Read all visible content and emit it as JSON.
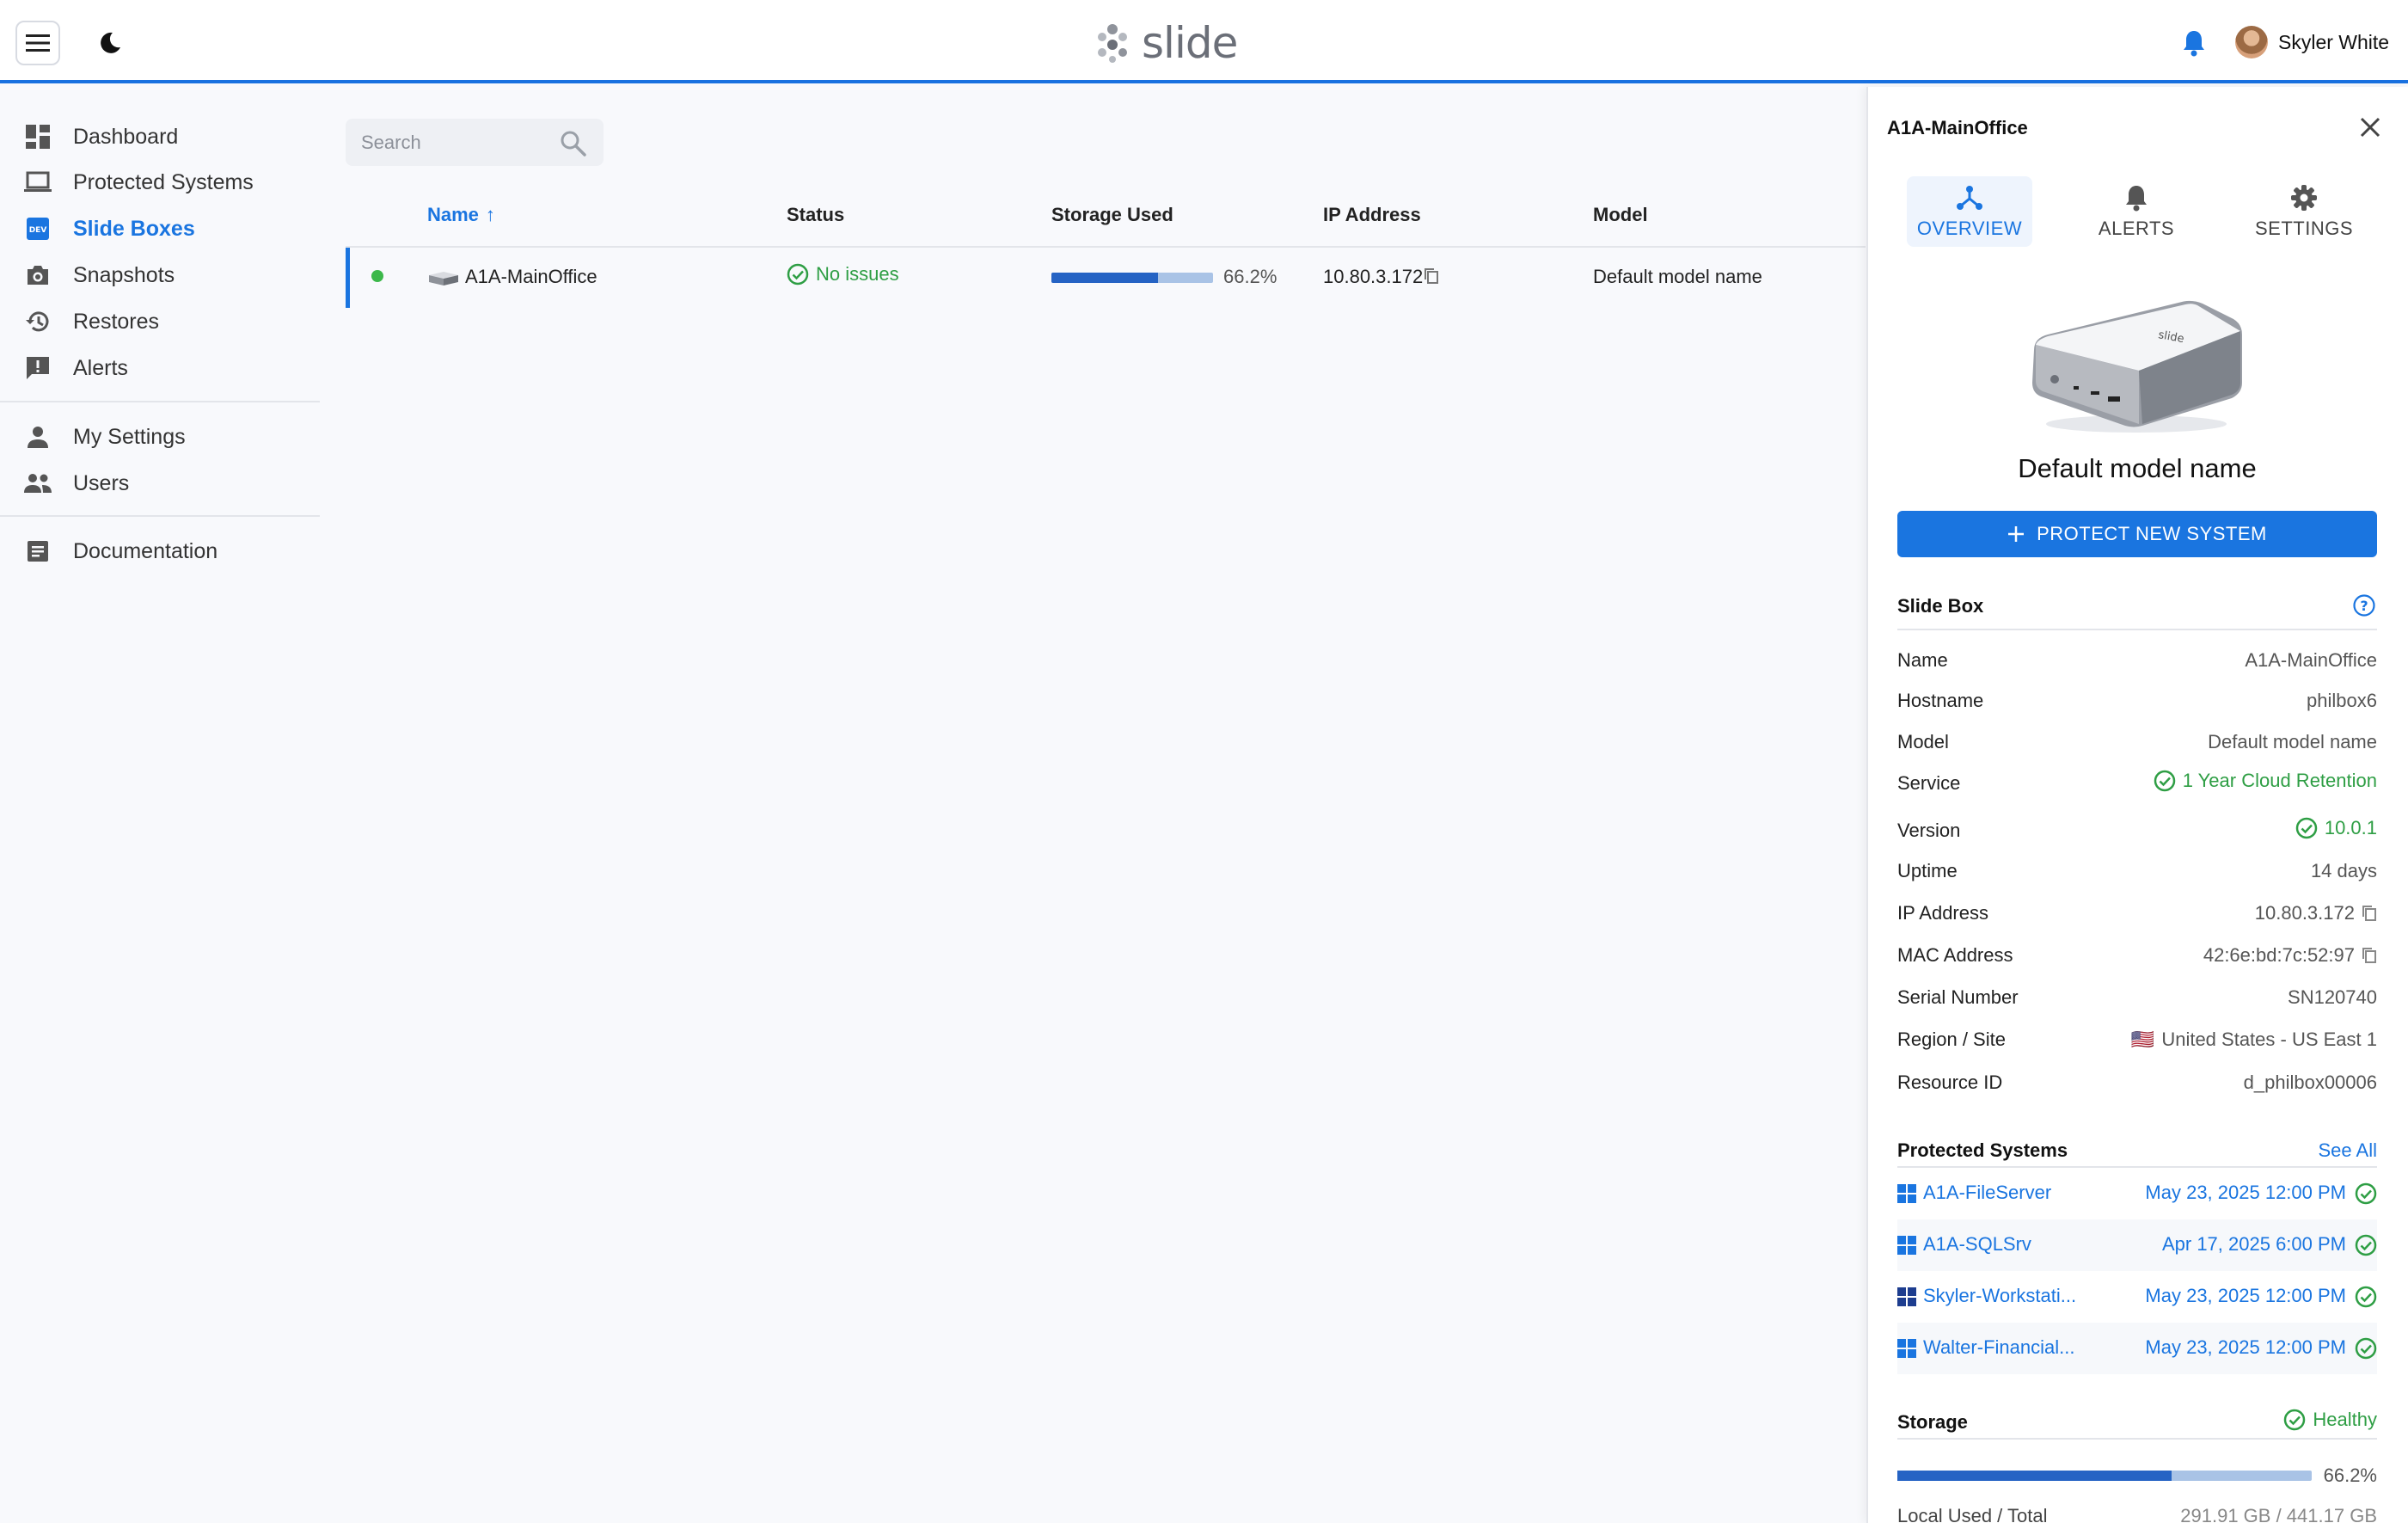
{
  "header": {
    "logo_text": "slide",
    "username": "Skyler White",
    "accent_color": "#1a75e0"
  },
  "sidebar": {
    "items": [
      {
        "label": "Dashboard",
        "icon": "dashboard-icon"
      },
      {
        "label": "Protected Systems",
        "icon": "laptop-icon"
      },
      {
        "label": "Slide Boxes",
        "icon": "dev-box-icon",
        "badge": "DEV",
        "active": true
      },
      {
        "label": "Snapshots",
        "icon": "camera-icon"
      },
      {
        "label": "Restores",
        "icon": "history-icon"
      },
      {
        "label": "Alerts",
        "icon": "alert-icon"
      },
      {
        "label": "My Settings",
        "icon": "person-icon"
      },
      {
        "label": "Users",
        "icon": "people-icon"
      },
      {
        "label": "Documentation",
        "icon": "document-icon"
      }
    ]
  },
  "search": {
    "placeholder": "Search"
  },
  "table": {
    "columns": [
      "Name",
      "Status",
      "Storage Used",
      "IP Address",
      "Model"
    ],
    "sort_indicator": "↑",
    "rows": [
      {
        "name": "A1A-MainOffice",
        "status": "No issues",
        "storage_percent": 66.2,
        "storage_label": "66.2%",
        "ip": "10.80.3.172",
        "model": "Default model name"
      }
    ]
  },
  "panel": {
    "title": "A1A-MainOffice",
    "tabs": [
      {
        "label": "OVERVIEW",
        "icon": "hub-icon",
        "active": true
      },
      {
        "label": "ALERTS",
        "icon": "bell-icon"
      },
      {
        "label": "SETTINGS",
        "icon": "gear-icon"
      }
    ],
    "device_print": "slide",
    "model_name": "Default model name",
    "protect_button": "PROTECT NEW SYSTEM",
    "slide_box": {
      "title": "Slide Box",
      "fields": [
        {
          "label": "Name",
          "value": "A1A-MainOffice"
        },
        {
          "label": "Hostname",
          "value": "philbox6"
        },
        {
          "label": "Model",
          "value": "Default model name"
        },
        {
          "label": "Service",
          "value": "1 Year Cloud Retention",
          "status": "ok"
        },
        {
          "label": "Version",
          "value": "10.0.1",
          "status": "ok"
        },
        {
          "label": "Uptime",
          "value": "14 days"
        },
        {
          "label": "IP Address",
          "value": "10.80.3.172",
          "copy": true
        },
        {
          "label": "MAC Address",
          "value": "42:6e:bd:7c:52:97",
          "copy": true
        },
        {
          "label": "Serial Number",
          "value": "SN120740"
        },
        {
          "label": "Region / Site",
          "value": "United States - US East 1",
          "flag": "🇺🇸"
        },
        {
          "label": "Resource ID",
          "value": "d_philbox00006"
        }
      ]
    },
    "protected_systems": {
      "title": "Protected Systems",
      "see_all": "See All",
      "items": [
        {
          "name": "A1A-FileServer",
          "date": "May 23, 2025 12:00 PM"
        },
        {
          "name": "A1A-SQLSrv",
          "date": "Apr 17, 2025 6:00 PM"
        },
        {
          "name": "Skyler-Workstati...",
          "date": "May 23, 2025 12:00 PM"
        },
        {
          "name": "Walter-Financial...",
          "date": "May 23, 2025 12:00 PM"
        }
      ]
    },
    "storage": {
      "title": "Storage",
      "status": "Healthy",
      "percent": 66.2,
      "percent_label": "66.2%",
      "local_label": "Local Used / Total",
      "local_value": "291.91 GB / 441.17 GB"
    }
  }
}
